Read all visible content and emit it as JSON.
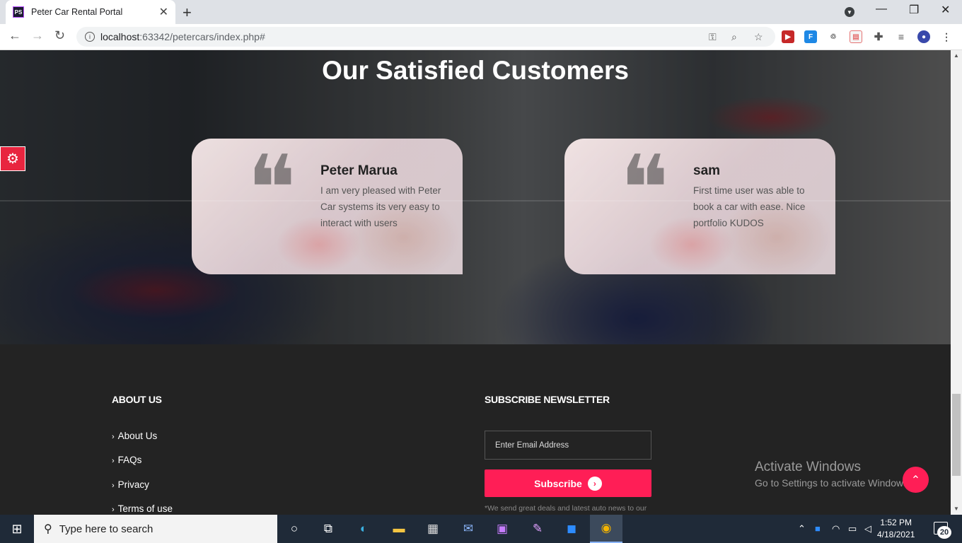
{
  "browser": {
    "tab_title": "Peter Car Rental Portal",
    "tab_favicon": "PS",
    "url_host": "localhost",
    "url_rest": ":63342/petercars/index.php#",
    "extensions": [
      "pdf-icon",
      "f-icon",
      "sync-icon",
      "tab-icon",
      "puzzle-icon",
      "reading-list-icon"
    ]
  },
  "testimonials": {
    "title_bold": "Our Satisfied",
    "title_light": "Customers",
    "items": [
      {
        "name": "Peter Marua",
        "text": "I am very pleased with Peter Car systems its very easy to interact with users"
      },
      {
        "name": "sam",
        "text": "First time user was able to book a car with ease. Nice portfolio KUDOS"
      }
    ]
  },
  "footer": {
    "about_heading": "ABOUT US",
    "links": [
      "About Us",
      "FAQs",
      "Privacy",
      "Terms of use"
    ],
    "newsletter_heading": "SUBSCRIBE NEWSLETTER",
    "email_placeholder": "Enter Email Address",
    "subscribe_label": "Subscribe",
    "note": "*We send great deals and latest auto news to our"
  },
  "watermark": {
    "line1": "Activate Windows",
    "line2": "Go to Settings to activate Windows."
  },
  "taskbar": {
    "search_placeholder": "Type here to search",
    "time": "1:52 PM",
    "date": "4/18/2021",
    "notifications": "20"
  },
  "colors": {
    "accent": "#ff1e56",
    "footer_bg": "#232323",
    "taskbar_bg": "#1f2a38"
  }
}
